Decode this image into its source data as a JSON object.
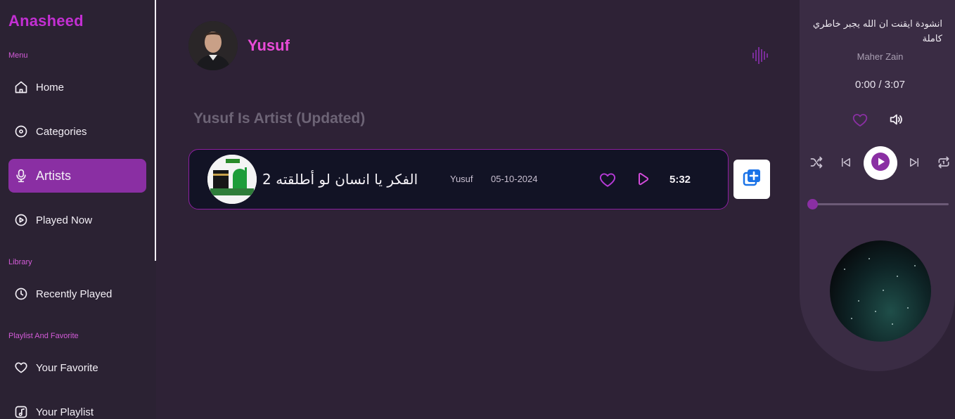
{
  "sidebar": {
    "brand": "Anasheed",
    "menu_label": "Menu",
    "library_label": "Library",
    "playlist_label": "Playlist And Favorite",
    "items": [
      {
        "label": "Home",
        "icon": "home-icon"
      },
      {
        "label": "Categories",
        "icon": "disc-icon"
      },
      {
        "label": "Artists",
        "icon": "microphone-icon",
        "active": true
      },
      {
        "label": "Played Now",
        "icon": "play-circle-icon"
      },
      {
        "label": "Recently Played",
        "icon": "clock-icon"
      },
      {
        "label": "Your Favorite",
        "icon": "heart-icon"
      },
      {
        "label": "Your Playlist",
        "icon": "music-list-icon"
      }
    ]
  },
  "artist": {
    "name": "Yusuf"
  },
  "section": {
    "title": "Yusuf Is Artist (Updated)"
  },
  "tracks": [
    {
      "title": "الفكر يا انسان لو أطلقته 2",
      "artist": "Yusuf",
      "date": "05-10-2024",
      "duration": "5:32"
    }
  ],
  "player": {
    "title": "انشودة ايقنت ان الله يجبر خاطري كاملة",
    "artist": "Maher Zain",
    "time": "0:00 / 3:07",
    "progress": 0
  },
  "colors": {
    "accent": "#8a2fa3",
    "brand": "#c32fd3",
    "artist_name": "#e94bd8",
    "background": "#2e2236"
  }
}
